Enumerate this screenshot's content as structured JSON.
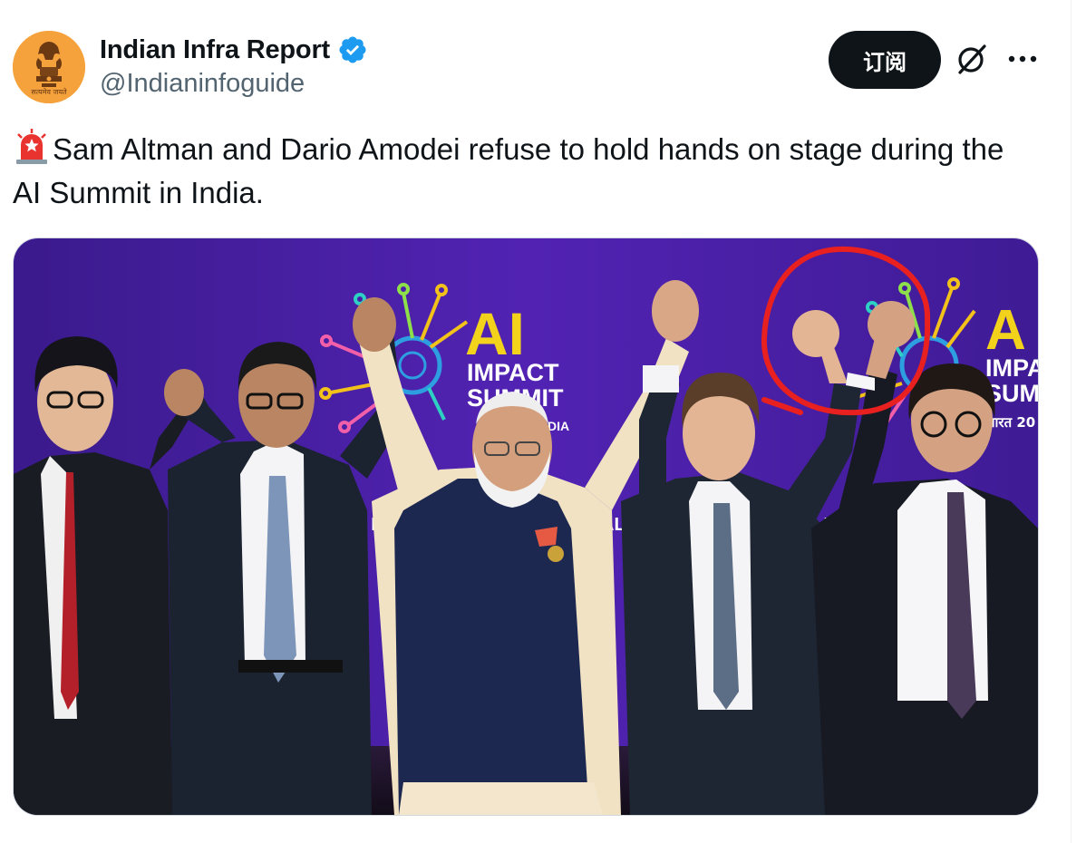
{
  "author": {
    "display_name": "Indian Infra Report",
    "handle": "@Indianinfoguide",
    "verified": true,
    "avatar_color": "#f6a23c",
    "avatar_motto": "सत्यमेव जयते"
  },
  "actions": {
    "subscribe_label": "订阅",
    "grok_icon": "grok-icon",
    "more_icon": "more-dots-icon"
  },
  "tweet": {
    "emoji": "rotating-light-icon",
    "text": "Sam Altman and Dario Amodei refuse to hold hands on stage during the AI Summit in India."
  },
  "media": {
    "backdrop_color": "#4b1fa6",
    "logo_title": "AI",
    "logo_line1": "IMPACT",
    "logo_line2": "SUMMIT",
    "logo_line3": "INDIA",
    "logo_title_right": "A",
    "logo_right_line1": "IMPA",
    "logo_right_line2": "SUM",
    "logo_right_line3": "भारत 20",
    "banner_left": ": FOR",
    "banner_mid": "AL",
    "banner_right": "ELFA",
    "annotation_color": "#e8201f"
  }
}
